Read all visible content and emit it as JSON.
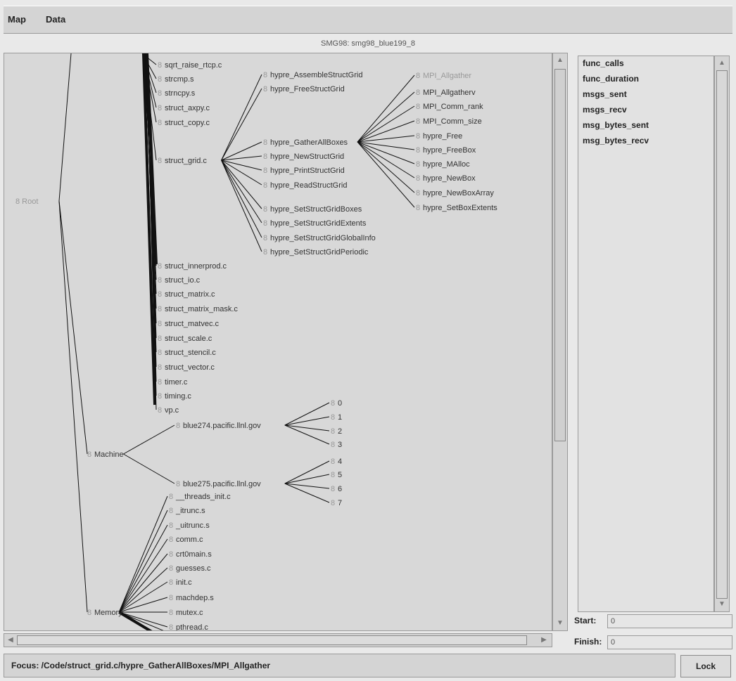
{
  "menu": {
    "items": [
      "Map",
      "Data"
    ]
  },
  "window_title": "SMG98: smg98_blue199_8",
  "tree": {
    "root_label": "Root",
    "nodes": [
      {
        "id": "sqrt_raise",
        "label": "sqrt_raise_rtcp.c"
      },
      {
        "id": "strcmp",
        "label": "strcmp.s"
      },
      {
        "id": "strncpy",
        "label": "strncpy.s"
      },
      {
        "id": "struct_axpy",
        "label": "struct_axpy.c"
      },
      {
        "id": "struct_copy",
        "label": "struct_copy.c"
      },
      {
        "id": "struct_grid",
        "label": "struct_grid.c"
      },
      {
        "id": "struct_innerprod",
        "label": "struct_innerprod.c"
      },
      {
        "id": "struct_io",
        "label": "struct_io.c"
      },
      {
        "id": "struct_matrix",
        "label": "struct_matrix.c"
      },
      {
        "id": "struct_matrix_mask",
        "label": "struct_matrix_mask.c"
      },
      {
        "id": "struct_matvec",
        "label": "struct_matvec.c"
      },
      {
        "id": "struct_scale",
        "label": "struct_scale.c"
      },
      {
        "id": "struct_stencil",
        "label": "struct_stencil.c"
      },
      {
        "id": "struct_vector",
        "label": "struct_vector.c"
      },
      {
        "id": "timer",
        "label": "timer.c"
      },
      {
        "id": "timing",
        "label": "timing.c"
      },
      {
        "id": "vp",
        "label": "vp.c"
      },
      {
        "id": "assemble",
        "label": "hypre_AssembleStructGrid"
      },
      {
        "id": "freestruct",
        "label": "hypre_FreeStructGrid"
      },
      {
        "id": "gather",
        "label": "hypre_GatherAllBoxes"
      },
      {
        "id": "newstruct",
        "label": "hypre_NewStructGrid"
      },
      {
        "id": "printstruct",
        "label": "hypre_PrintStructGrid"
      },
      {
        "id": "readstruct",
        "label": "hypre_ReadStructGrid"
      },
      {
        "id": "setboxes",
        "label": "hypre_SetStructGridBoxes"
      },
      {
        "id": "setextents",
        "label": "hypre_SetStructGridExtents"
      },
      {
        "id": "setglobal",
        "label": "hypre_SetStructGridGlobalInfo"
      },
      {
        "id": "setperiodic",
        "label": "hypre_SetStructGridPeriodic"
      },
      {
        "id": "mpi_allgather",
        "label": "MPI_Allgather"
      },
      {
        "id": "mpi_allgatherv",
        "label": "MPI_Allgatherv"
      },
      {
        "id": "mpi_comm_rank",
        "label": "MPI_Comm_rank"
      },
      {
        "id": "mpi_comm_size",
        "label": "MPI_Comm_size"
      },
      {
        "id": "hfree",
        "label": "hypre_Free"
      },
      {
        "id": "hfreebox",
        "label": "hypre_FreeBox"
      },
      {
        "id": "hmalloc",
        "label": "hypre_MAlloc"
      },
      {
        "id": "hnewbox",
        "label": "hypre_NewBox"
      },
      {
        "id": "hnewboxarray",
        "label": "hypre_NewBoxArray"
      },
      {
        "id": "hsetboxextents",
        "label": "hypre_SetBoxExtents"
      },
      {
        "id": "machine",
        "label": "Machine"
      },
      {
        "id": "blue274",
        "label": "blue274.pacific.llnl.gov"
      },
      {
        "id": "blue275",
        "label": "blue275.pacific.llnl.gov"
      },
      {
        "id": "p0",
        "label": "0"
      },
      {
        "id": "p1",
        "label": "1"
      },
      {
        "id": "p2",
        "label": "2"
      },
      {
        "id": "p3",
        "label": "3"
      },
      {
        "id": "p4",
        "label": "4"
      },
      {
        "id": "p5",
        "label": "5"
      },
      {
        "id": "p6",
        "label": "6"
      },
      {
        "id": "p7",
        "label": "7"
      },
      {
        "id": "threads_init",
        "label": "__threads_init.c"
      },
      {
        "id": "itrunc",
        "label": "_itrunc.s"
      },
      {
        "id": "uitrunc",
        "label": "_uitrunc.s"
      },
      {
        "id": "comm",
        "label": "comm.c"
      },
      {
        "id": "crt0main",
        "label": "crt0main.s"
      },
      {
        "id": "guesses",
        "label": "guesses.c"
      },
      {
        "id": "init",
        "label": "init.c"
      },
      {
        "id": "machdep",
        "label": "machdep.s"
      },
      {
        "id": "mutex",
        "label": "mutex.c"
      },
      {
        "id": "pthread",
        "label": "pthread.c"
      },
      {
        "id": "memory",
        "label": "Memory"
      }
    ]
  },
  "metrics": {
    "items": [
      "func_calls",
      "func_duration",
      "msgs_sent",
      "msgs_recv",
      "msg_bytes_sent",
      "msg_bytes_recv"
    ]
  },
  "range": {
    "start_label": "Start:",
    "start_value": "0",
    "finish_label": "Finish:",
    "finish_value": "0"
  },
  "status": {
    "focus_text": "Focus: /Code/struct_grid.c/hypre_GatherAllBoxes/MPI_Allgather",
    "lock_label": "Lock"
  }
}
